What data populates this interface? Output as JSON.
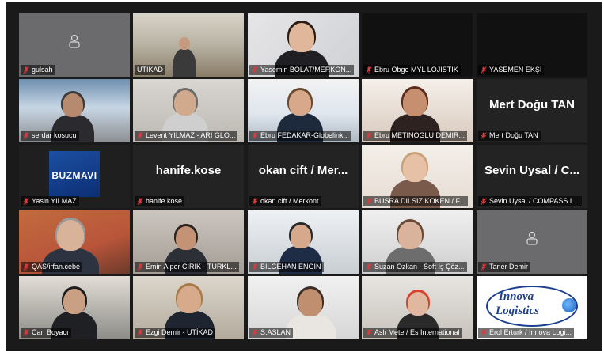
{
  "tiles": [
    {
      "name": "gulsah",
      "type": "avatar"
    },
    {
      "name": "UTİKAD",
      "type": "video",
      "active": true
    },
    {
      "name": "Yasemin BOLAT/MERKON...",
      "type": "video"
    },
    {
      "name": "Ebru Obge MYL LOJISTIK",
      "type": "blank"
    },
    {
      "name": "YASEMEN EKŞİ",
      "type": "blank"
    },
    {
      "name": "serdar kosucu",
      "type": "video"
    },
    {
      "name": "Levent YILMAZ - ARI GLO...",
      "type": "video"
    },
    {
      "name": "Ebru FEDAKAR-Globelink...",
      "type": "video"
    },
    {
      "name": "Ebru METINOGLU DEMIR...",
      "type": "video"
    },
    {
      "name": "Mert Doğu TAN",
      "type": "text",
      "display": "Mert Doğu TAN"
    },
    {
      "name": "Yasin YILMAZ",
      "type": "logo",
      "logo_text": "BUZMAVI"
    },
    {
      "name": "hanife.kose",
      "type": "text",
      "display": "hanife.kose"
    },
    {
      "name": "okan cift / Merkont",
      "type": "text",
      "display": "okan cift / Mer..."
    },
    {
      "name": "BUSRA DILSIZ KOKEN / F...",
      "type": "video"
    },
    {
      "name": "Sevin Uysal / COMPASS L...",
      "type": "text",
      "display": "Sevin Uysal / C..."
    },
    {
      "name": "QAS/irfan.cebe",
      "type": "video"
    },
    {
      "name": "Emin Alper CIRIK - TURKL...",
      "type": "video"
    },
    {
      "name": "BILGEHAN ENGIN",
      "type": "video"
    },
    {
      "name": "Suzan Özkan - Soft İş Çöz...",
      "type": "video"
    },
    {
      "name": "Taner Demir",
      "type": "avatar"
    },
    {
      "name": "Can Boyacı",
      "type": "video"
    },
    {
      "name": "Ezgi Demir - UTİKAD",
      "type": "video"
    },
    {
      "name": "S.ASLAN",
      "type": "video"
    },
    {
      "name": "Aslı Mete / Es International",
      "type": "video"
    },
    {
      "name": "Erol Erturk / Innova Logi...",
      "type": "innova",
      "logo_line1": "Innova",
      "logo_line2": "Logistics"
    }
  ],
  "colors": {
    "background": "#1a1a1a",
    "tile": "#232323",
    "active_border": "#c8e04a",
    "muted_icon": "#e0383e"
  }
}
